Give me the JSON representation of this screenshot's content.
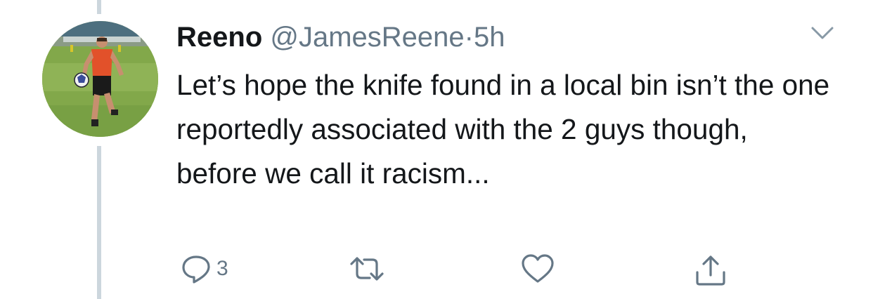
{
  "tweet": {
    "author_name": "Reeno",
    "handle": "@JamesReene",
    "separator": "·",
    "time": "5h",
    "text": "Let’s hope the knife found in a local bin isn’t the one reportedly associated with the 2 guys though, before we call it racism...",
    "avatar_icon": "player-photo-avatar",
    "menu_icon": "chevron-down-icon"
  },
  "actions": {
    "reply_icon": "reply-icon",
    "reply_count": "3",
    "retweet_icon": "retweet-icon",
    "like_icon": "heart-icon",
    "share_icon": "share-icon"
  },
  "colors": {
    "text": "#14171a",
    "secondary": "#657786",
    "thread_line": "#ccd6dd"
  }
}
